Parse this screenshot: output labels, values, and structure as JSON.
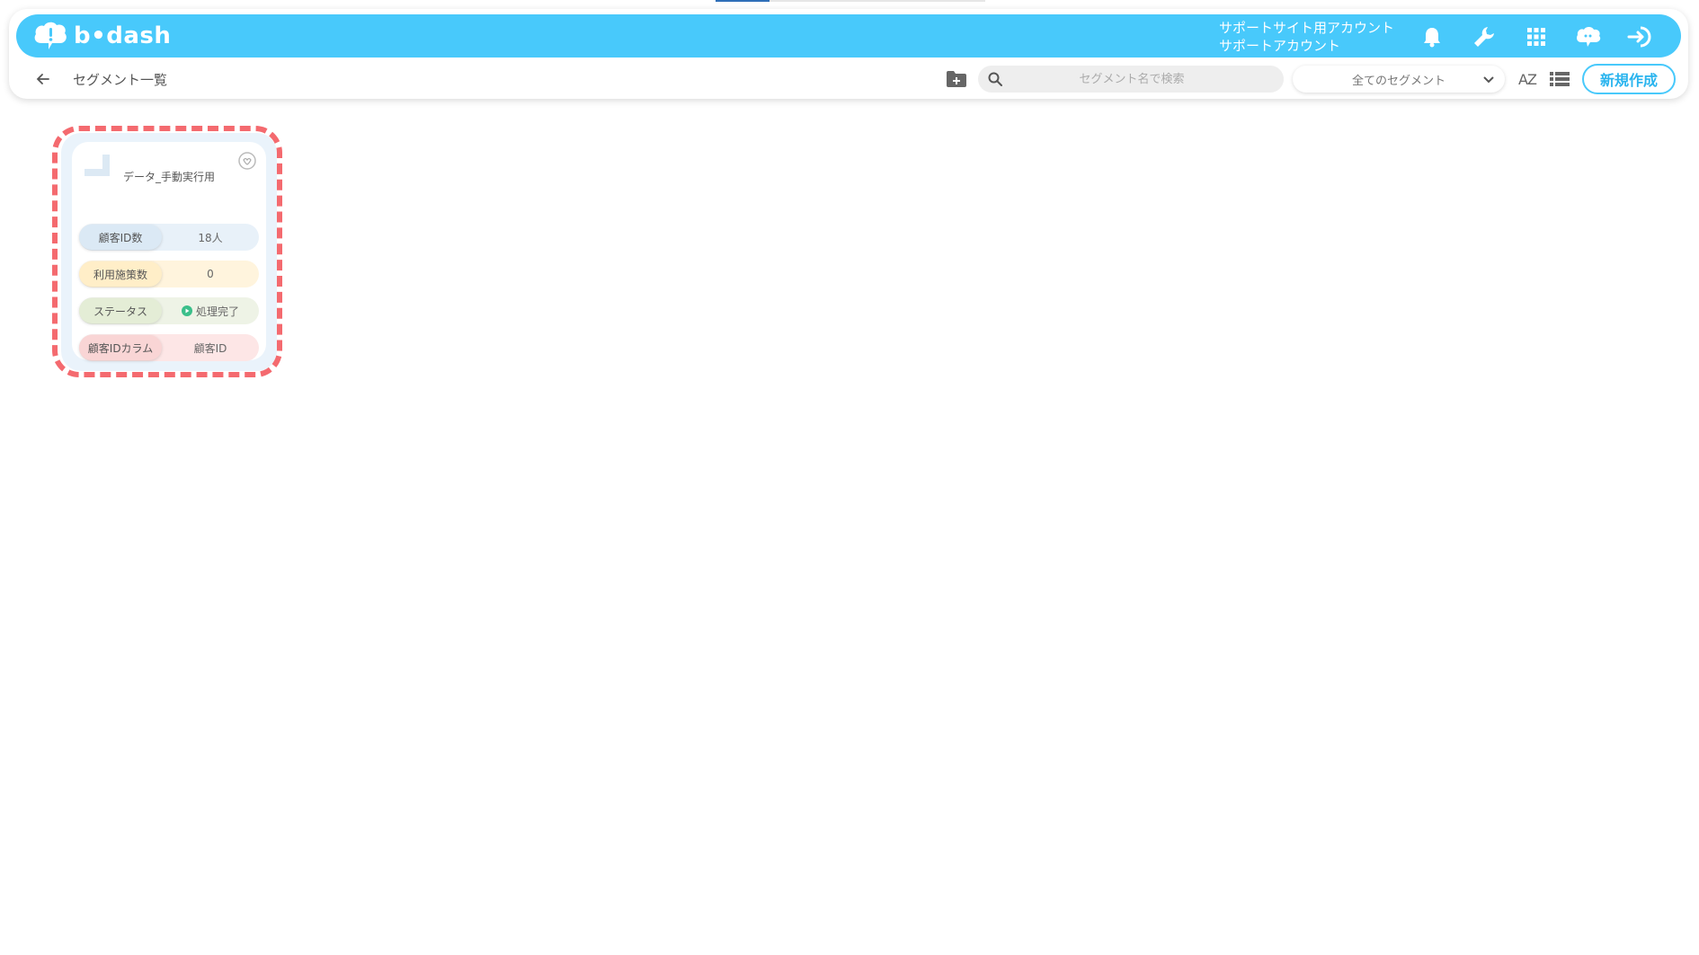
{
  "header": {
    "logo_text": "b•dash",
    "account_line1": "サポートサイト用アカウント",
    "account_line2": "サポートアカウント",
    "icons": [
      "bell-icon",
      "wrench-icon",
      "apps-grid-icon",
      "chat-cloud-icon",
      "logout-icon"
    ]
  },
  "subbar": {
    "title": "セグメント一覧",
    "search_placeholder": "セグメント名で検索",
    "filter_selected": "全てのセグメント",
    "sort_label": "AZ",
    "new_button": "新規作成"
  },
  "segments": [
    {
      "name": "データ_手動実行用",
      "stats": [
        {
          "label": "顧客ID数",
          "value": "18人"
        },
        {
          "label": "利用施策数",
          "value": "0"
        },
        {
          "label": "ステータス",
          "value": "処理完了"
        },
        {
          "label": "顧客IDカラム",
          "value": "顧客ID"
        }
      ]
    }
  ],
  "colors": {
    "brand": "#48c9fb",
    "highlight": "#f46a6f",
    "status_ok": "#3bbf8a"
  }
}
